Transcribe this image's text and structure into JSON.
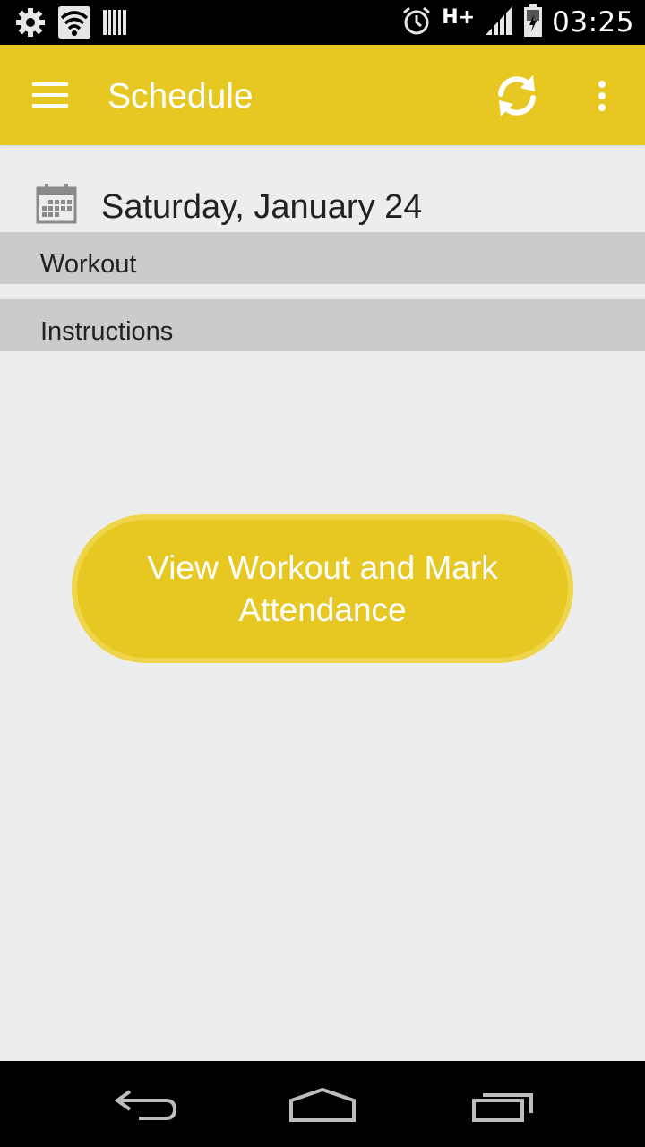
{
  "status_bar": {
    "time": "03:25",
    "network_type": "H+",
    "left_icons": [
      "settings-icon",
      "wifi-icon",
      "barcode-icon"
    ],
    "right_icons": [
      "alarm-icon",
      "signal-icon",
      "battery-icon"
    ]
  },
  "app_bar": {
    "title": "Schedule",
    "background_color": "#e7c822",
    "actions": [
      "menu-icon",
      "sync-icon",
      "overflow-icon"
    ]
  },
  "schedule": {
    "date": "Saturday, January 24",
    "sections": [
      {
        "label": "Workout"
      },
      {
        "label": "Instructions"
      }
    ],
    "primary_action": "View Workout and Mark Attendance"
  },
  "nav_bar": {
    "buttons": [
      "back-icon",
      "home-icon",
      "recents-icon"
    ]
  }
}
